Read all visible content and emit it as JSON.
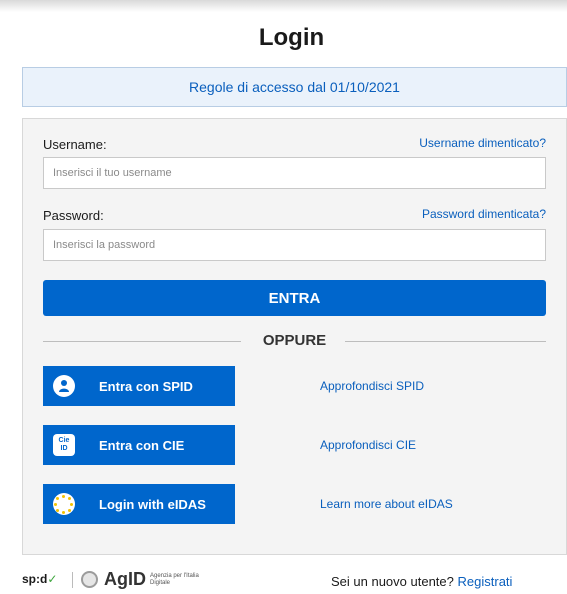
{
  "title": "Login",
  "notice": "Regole di accesso dal 01/10/2021",
  "form": {
    "username_label": "Username:",
    "username_forgot": "Username dimenticato?",
    "username_placeholder": "Inserisci il tuo username",
    "password_label": "Password:",
    "password_forgot": "Password dimenticata?",
    "password_placeholder": "Inserisci la password",
    "submit_label": "ENTRA",
    "or_label": "OPPURE"
  },
  "identity_providers": [
    {
      "label": "Entra con SPID",
      "icon": "spid-user-icon",
      "more": "Approfondisci SPID"
    },
    {
      "label": "Entra con CIE",
      "icon": "cie-icon",
      "more": "Approfondisci CIE"
    },
    {
      "label": "Login with eIDAS",
      "icon": "eidas-icon",
      "more": "Learn more about eIDAS"
    }
  ],
  "footer": {
    "spid_logo": "sp:d",
    "agid_logo": "AgID",
    "agid_sub": "Agenzia per l'Italia Digitale",
    "new_user_text": "Sei un nuovo utente?",
    "register_link": "Registrati"
  },
  "colors": {
    "primary": "#0066cc",
    "link": "#0a5fbd",
    "panel_bg": "#f4f4f4",
    "notice_bg": "#eaf2fb"
  }
}
